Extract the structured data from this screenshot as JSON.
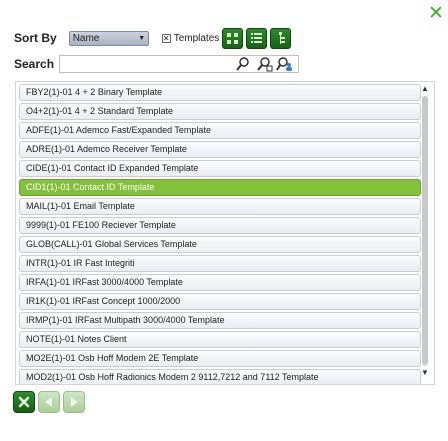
{
  "window": {
    "close_glyph": "✕"
  },
  "sort": {
    "label": "Sort By",
    "selected": "Name",
    "templates_checkbox_checked": true,
    "templates_label": "Templates",
    "view_buttons": [
      "grid-view-icon",
      "list-view-icon",
      "tree-view-icon"
    ]
  },
  "search": {
    "label": "Search",
    "value": "",
    "icons": [
      "search-icon",
      "advanced-search-icon",
      "search-user-icon"
    ]
  },
  "templates": [
    {
      "code": "FBY2(1)-01",
      "name": "4 + 2 Binary Template"
    },
    {
      "code": "O4+2(1)-01",
      "name": "4 + 2 Standard Template"
    },
    {
      "code": "ADFE(1)-01",
      "name": "Ademco Fast/Expanded Template"
    },
    {
      "code": "ADRE(1)-01",
      "name": "Ademco Receiver Template"
    },
    {
      "code": "CIDE(1)-01",
      "name": "Contact ID Expanded Template"
    },
    {
      "code": "CID1(1)-01",
      "name": "Contact ID Template",
      "selected": true
    },
    {
      "code": "MAIL(1)-01",
      "name": "Email Template"
    },
    {
      "code": "9999(1)-01",
      "name": "FE100 Reciever Template"
    },
    {
      "code": "GLOB(CALL)-01",
      "name": "Global Services Template"
    },
    {
      "code": "INTR(1)-01",
      "name": "IR Fast Integriti"
    },
    {
      "code": "IRFA(1)-01",
      "name": "IRFast 3000/4000 Template"
    },
    {
      "code": "IR1K(1)-01",
      "name": "IRFast Concept 1000/2000"
    },
    {
      "code": "IRMP(1)-01",
      "name": "IRFast Multipath 3000/4000 Template"
    },
    {
      "code": "NOTE(1)-01",
      "name": "Notes Client"
    },
    {
      "code": "MO2E(1)-01",
      "name": "Osb Hoff Modem 2E Template"
    },
    {
      "code": "MOD2(1)-01",
      "name": "Osb Hoff Radionics Modem 2 9112,7212 and 7112 Template"
    }
  ],
  "footer": {
    "buttons": [
      "cancel-icon",
      "previous-icon",
      "next-icon"
    ]
  },
  "colors": {
    "accent_green": "#3fae2a",
    "selected_row": "#84c13a",
    "button_green": "#1f7a1d"
  }
}
